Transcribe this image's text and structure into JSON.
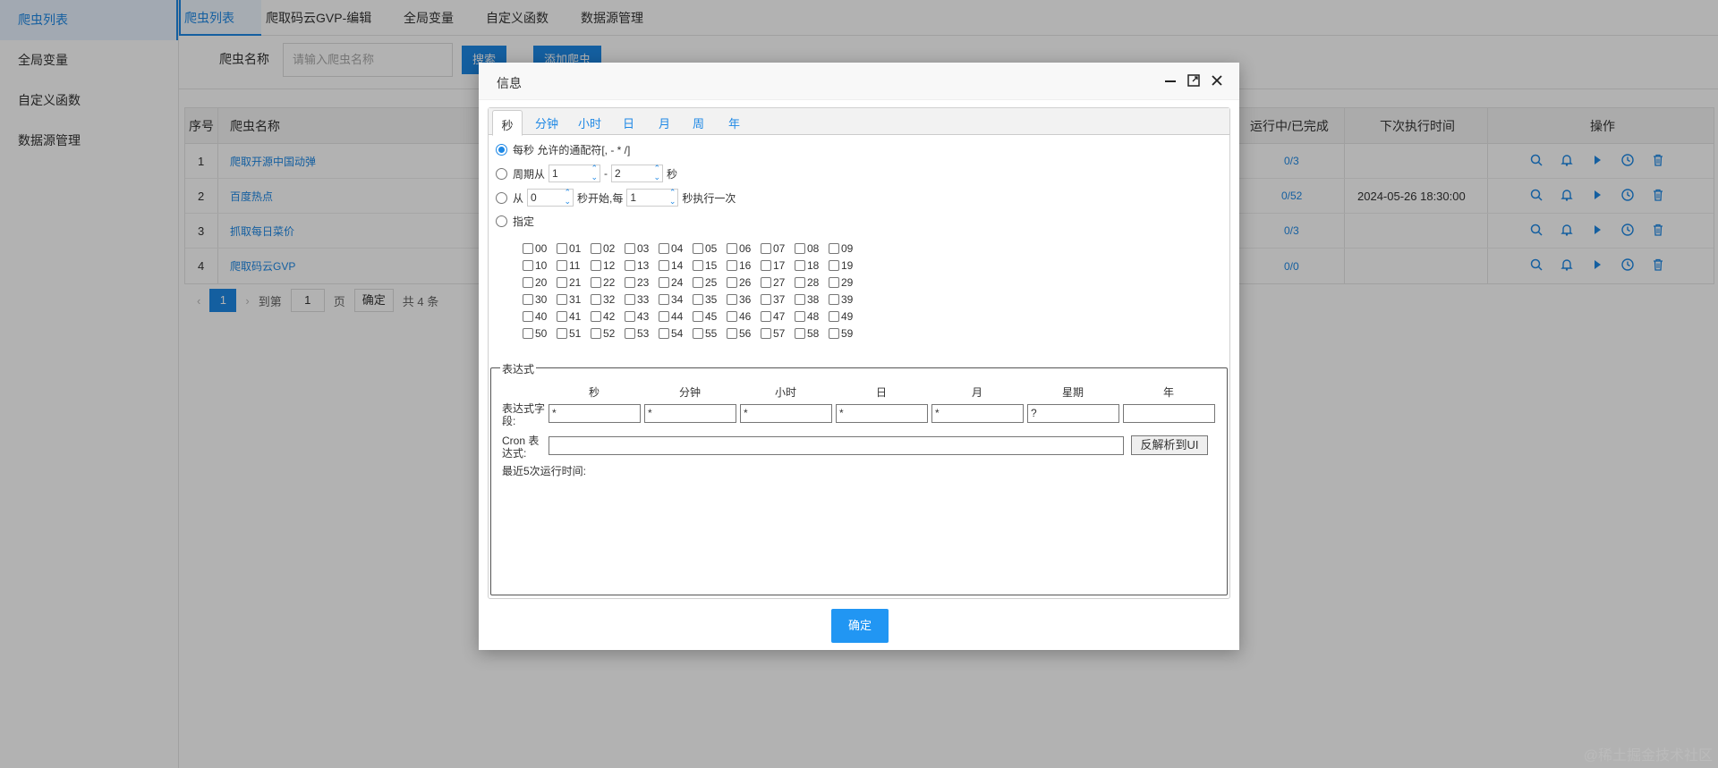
{
  "sidebar": {
    "items": [
      {
        "label": "爬虫列表",
        "active": true
      },
      {
        "label": "全局变量"
      },
      {
        "label": "自定义函数"
      },
      {
        "label": "数据源管理"
      }
    ]
  },
  "tabs": [
    {
      "label": "爬虫列表",
      "active": true
    },
    {
      "label": "爬取码云GVP-编辑"
    },
    {
      "label": "全局变量"
    },
    {
      "label": "自定义函数"
    },
    {
      "label": "数据源管理"
    }
  ],
  "search": {
    "label": "爬虫名称",
    "placeholder": "请输入爬虫名称",
    "search_btn": "搜索",
    "add_btn": "添加爬虫"
  },
  "table": {
    "headers": {
      "seq": "序号",
      "name": "爬虫名称",
      "running": "运行中/已完成",
      "next": "下次执行时间",
      "ops": "操作"
    },
    "rows": [
      {
        "seq": "1",
        "name": "爬取开源中国动弹",
        "running": "0/3",
        "next": ""
      },
      {
        "seq": "2",
        "name": "百度热点",
        "running": "0/52",
        "next": "2024-05-26 18:30:00"
      },
      {
        "seq": "3",
        "name": "抓取每日菜价",
        "running": "0/3",
        "next": ""
      },
      {
        "seq": "4",
        "name": "爬取码云GVP",
        "running": "0/0",
        "next": ""
      }
    ]
  },
  "pager": {
    "current": "1",
    "goto": "到第",
    "page_input": "1",
    "page_unit": "页",
    "confirm": "确定",
    "total": "共 4 条"
  },
  "dialog": {
    "title": "信息",
    "tabs": [
      "秒",
      "分钟",
      "小时",
      "日",
      "月",
      "周",
      "年"
    ],
    "opt_every": "每秒 允许的通配符[, - * /]",
    "opt_cycle_prefix": "周期从",
    "cycle_from": "1",
    "cycle_dash": "-",
    "cycle_to": "2",
    "cycle_suffix": "秒",
    "opt_from_prefix": "从",
    "from_start": "0",
    "from_mid": "秒开始,每",
    "from_every": "1",
    "from_suffix": "秒执行一次",
    "opt_specify": "指定",
    "checkboxes": [
      [
        "00",
        "01",
        "02",
        "03",
        "04",
        "05",
        "06",
        "07",
        "08",
        "09"
      ],
      [
        "10",
        "11",
        "12",
        "13",
        "14",
        "15",
        "16",
        "17",
        "18",
        "19"
      ],
      [
        "20",
        "21",
        "22",
        "23",
        "24",
        "25",
        "26",
        "27",
        "28",
        "29"
      ],
      [
        "30",
        "31",
        "32",
        "33",
        "34",
        "35",
        "36",
        "37",
        "38",
        "39"
      ],
      [
        "40",
        "41",
        "42",
        "43",
        "44",
        "45",
        "46",
        "47",
        "48",
        "49"
      ],
      [
        "50",
        "51",
        "52",
        "53",
        "54",
        "55",
        "56",
        "57",
        "58",
        "59"
      ]
    ],
    "expr": {
      "legend": "表达式",
      "cols": [
        "秒",
        "分钟",
        "小时",
        "日",
        "月",
        "星期",
        "年"
      ],
      "values": [
        "*",
        "*",
        "*",
        "*",
        "*",
        "?",
        ""
      ],
      "field_label": "表达式字段:",
      "cron_label": "Cron 表达式:",
      "cron_value": "",
      "reverse_btn": "反解析到UI",
      "recent_label": "最近5次运行时间:"
    },
    "ok": "确定"
  },
  "watermark": "@稀土掘金技术社区"
}
